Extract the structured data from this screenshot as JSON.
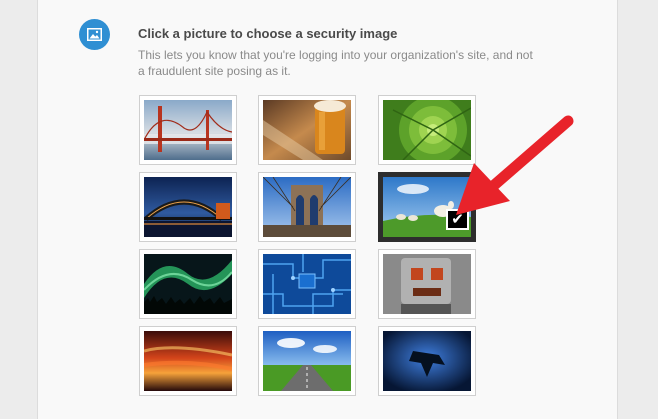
{
  "section": {
    "icon": "image-icon",
    "title": "Click a picture to choose a security image",
    "description": "This lets you know that you're logging into your organization's site, and not a fraudulent site posing as it."
  },
  "images": [
    {
      "name": "golden-gate-bridge",
      "selected": false
    },
    {
      "name": "beer-glass",
      "selected": false
    },
    {
      "name": "green-succulent",
      "selected": false
    },
    {
      "name": "harbour-bridge-night",
      "selected": false
    },
    {
      "name": "brooklyn-bridge",
      "selected": false
    },
    {
      "name": "sheep-on-hill",
      "selected": true
    },
    {
      "name": "aurora-lights",
      "selected": false
    },
    {
      "name": "circuit-board",
      "selected": false
    },
    {
      "name": "robot-toy",
      "selected": false
    },
    {
      "name": "red-sunset-sky",
      "selected": false
    },
    {
      "name": "open-road",
      "selected": false
    },
    {
      "name": "manta-ray",
      "selected": false
    }
  ],
  "colors": {
    "accent": "#2f8fd3",
    "arrow": "#e8232a",
    "selected_frame": "#2d2d2d"
  }
}
